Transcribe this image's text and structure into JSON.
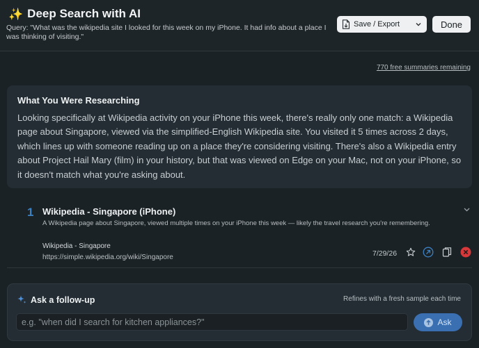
{
  "header": {
    "title": "Deep Search with AI",
    "query": "Query: \"What was the wikipedia site I looked for this week on my iPhone.  It had info about a place I was thinking of visiting.\"",
    "save_label": "Save / Export",
    "done_label": "Done"
  },
  "summaries_remaining": "770 free summaries remaining",
  "research": {
    "title": "What You Were Researching",
    "body": "Looking specifically at Wikipedia activity on your iPhone this week, there's really only one match: a Wikipedia page about Singapore, viewed via the simplified-English Wikipedia site. You visited it 5 times across 2 days, which lines up with someone reading up on a place they're considering visiting. There's also a Wikipedia entry about Project Hail Mary (film) in your history, but that was viewed on Edge on your Mac, not on your iPhone, so it doesn't match what you're asking about."
  },
  "results": [
    {
      "rank": "1",
      "title": "Wikipedia - Singapore (iPhone)",
      "description": "A Wikipedia page about Singapore, viewed multiple times on your iPhone this week — likely the travel research you're remembering.",
      "source": "Wikipedia - Singapore",
      "url": "https://simple.wikipedia.org/wiki/Singapore",
      "date": "7/29/26"
    }
  ],
  "followup": {
    "title": "Ask a follow-up",
    "hint": "Refines with a fresh sample each time",
    "placeholder": "e.g. \"when did I search for kitchen appliances?\"",
    "ask_label": "Ask"
  },
  "colors": {
    "background": "#1b2226",
    "card": "#232d33",
    "accent": "#3a6fb2",
    "rank": "#3b82c4",
    "delete": "#d9383a"
  },
  "icons": {
    "title": "sparkles-icon",
    "save": "document-icon",
    "followup": "sparkle-icon",
    "ask": "arrow-up-circle-icon"
  }
}
